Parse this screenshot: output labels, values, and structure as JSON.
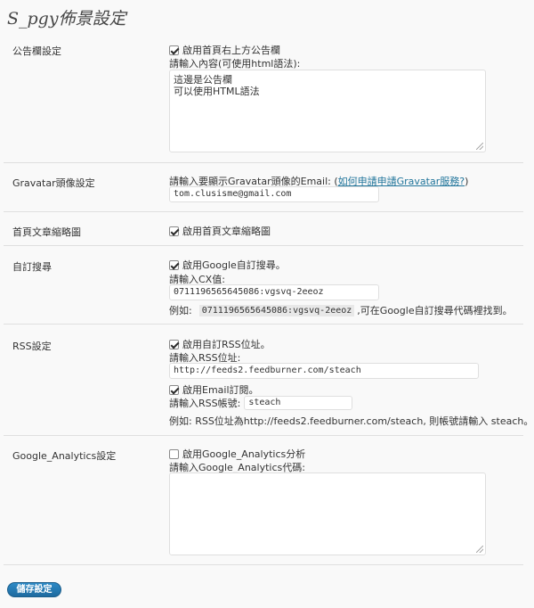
{
  "title": "S_pgy佈景設定",
  "announcement": {
    "label": "公告欄設定",
    "enable_label": "啟用首頁右上方公告欄",
    "enabled": true,
    "prompt": "請輸入內容(可使用html語法):",
    "content_lines": [
      "這邊是公告欄",
      "可以使用HTML語法"
    ]
  },
  "gravatar": {
    "label": "Gravatar頭像設定",
    "prompt": "請輸入要顯示Gravatar頭像的Email:",
    "link_text": "如何申請申請Gravatar服務?",
    "value": "tom.clusisme@gmail.com"
  },
  "excerpt": {
    "label": "首頁文章縮略圖",
    "enable_label": "啟用首頁文章縮略圖",
    "enabled": true
  },
  "custom_search": {
    "label": "自訂搜尋",
    "enable_label": "啟用Google自訂搜尋。",
    "enabled": true,
    "prompt": "請輸入CX值:",
    "value": "0711196565645086:vgsvq-2eeoz",
    "example_prefix": "例如:",
    "example_code": "0711196565645086:vgsvq-2eeoz",
    "example_suffix": ",可在Google自訂搜尋代碼裡找到。"
  },
  "rss": {
    "label": "RSS設定",
    "enable_label": "啟用自訂RSS位址。",
    "enabled": true,
    "prompt": "請輸入RSS位址:",
    "value": "http://feeds2.feedburner.com/steach",
    "email_label": "啟用Email訂閱。",
    "email_enabled": true,
    "account_prompt": "請輸入RSS帳號:",
    "account_value": "steach",
    "example": "例如: RSS位址為http://feeds2.feedburner.com/steach, 則帳號請輸入 steach。"
  },
  "analytics": {
    "label": "Google_Analytics設定",
    "enable_label": "啟用Google_Analytics分析",
    "enabled": false,
    "prompt": "請輸入Google_Analytics代碼:",
    "value": ""
  },
  "save_label": "儲存設定"
}
